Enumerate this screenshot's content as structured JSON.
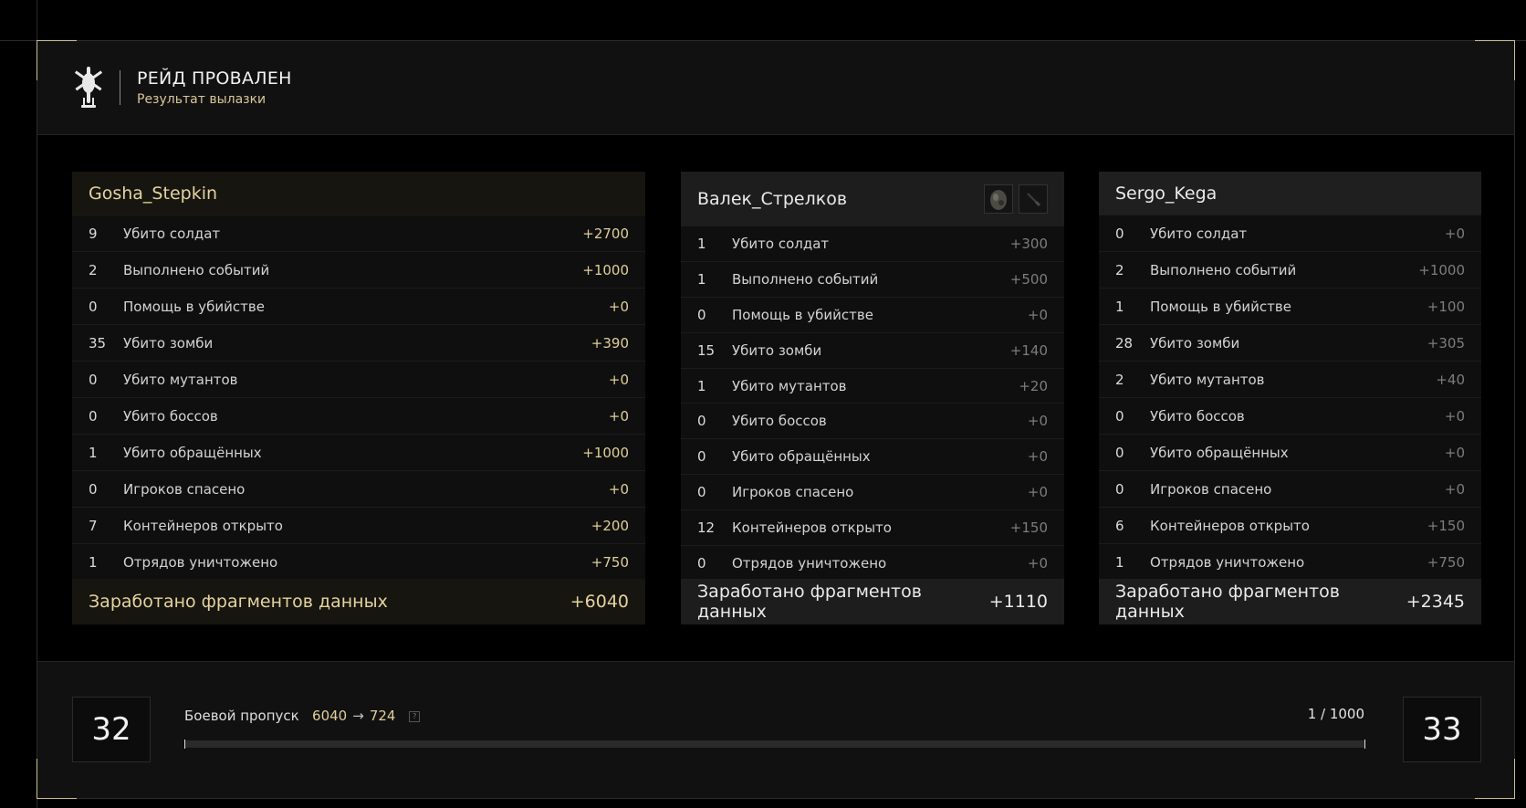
{
  "header": {
    "title": "РЕЙД ПРОВАЛЕН",
    "subtitle": "Результат вылазки",
    "logo_icon": "helicopter-icon"
  },
  "players": [
    {
      "name": "Gosha_Stepkin",
      "highlight": true,
      "stats": [
        {
          "count": "9",
          "label": "Убито солдат",
          "points": "+2700"
        },
        {
          "count": "2",
          "label": "Выполнено событий",
          "points": "+1000"
        },
        {
          "count": "0",
          "label": "Помощь в убийстве",
          "points": "+0"
        },
        {
          "count": "35",
          "label": "Убито зомби",
          "points": "+390"
        },
        {
          "count": "0",
          "label": "Убито мутантов",
          "points": "+0"
        },
        {
          "count": "0",
          "label": "Убито боссов",
          "points": "+0"
        },
        {
          "count": "1",
          "label": "Убито обращённых",
          "points": "+1000"
        },
        {
          "count": "0",
          "label": "Игроков спасено",
          "points": "+0"
        },
        {
          "count": "7",
          "label": "Контейнеров открыто",
          "points": "+200"
        },
        {
          "count": "1",
          "label": "Отрядов уничтожено",
          "points": "+750"
        }
      ],
      "total_label": "Заработано фрагментов данных",
      "total": "+6040"
    },
    {
      "name": "Валек_Стрелков",
      "highlight": false,
      "slot_icons": [
        "gear-item-icon",
        "knife-icon"
      ],
      "stats": [
        {
          "count": "1",
          "label": "Убито солдат",
          "points": "+300"
        },
        {
          "count": "1",
          "label": "Выполнено событий",
          "points": "+500"
        },
        {
          "count": "0",
          "label": "Помощь в убийстве",
          "points": "+0"
        },
        {
          "count": "15",
          "label": "Убито зомби",
          "points": "+140"
        },
        {
          "count": "1",
          "label": "Убито мутантов",
          "points": "+20"
        },
        {
          "count": "0",
          "label": "Убито боссов",
          "points": "+0"
        },
        {
          "count": "0",
          "label": "Убито обращённых",
          "points": "+0"
        },
        {
          "count": "0",
          "label": "Игроков спасено",
          "points": "+0"
        },
        {
          "count": "12",
          "label": "Контейнеров открыто",
          "points": "+150"
        },
        {
          "count": "0",
          "label": "Отрядов уничтожено",
          "points": "+0"
        }
      ],
      "total_label": "Заработано фрагментов данных",
      "total": "+1110"
    },
    {
      "name": "Sergo_Kega",
      "highlight": false,
      "stats": [
        {
          "count": "0",
          "label": "Убито солдат",
          "points": "+0"
        },
        {
          "count": "2",
          "label": "Выполнено событий",
          "points": "+1000"
        },
        {
          "count": "1",
          "label": "Помощь в убийстве",
          "points": "+100"
        },
        {
          "count": "28",
          "label": "Убито зомби",
          "points": "+305"
        },
        {
          "count": "2",
          "label": "Убито мутантов",
          "points": "+40"
        },
        {
          "count": "0",
          "label": "Убито боссов",
          "points": "+0"
        },
        {
          "count": "0",
          "label": "Убито обращённых",
          "points": "+0"
        },
        {
          "count": "0",
          "label": "Игроков спасено",
          "points": "+0"
        },
        {
          "count": "6",
          "label": "Контейнеров открыто",
          "points": "+150"
        },
        {
          "count": "1",
          "label": "Отрядов уничтожено",
          "points": "+750"
        }
      ],
      "total_label": "Заработано фрагментов данных",
      "total": "+2345"
    }
  ],
  "battlepass": {
    "label": "Боевой пропуск",
    "from": "6040",
    "arrow": "→",
    "to": "724",
    "help": "?",
    "current_level": "32",
    "next_level": "33",
    "progress_text": "1 / 1000",
    "progress_fraction": 0.001
  },
  "colors": {
    "accent_gold": "#e0cf98",
    "panel_bg": "#111111",
    "background": "#000000"
  }
}
